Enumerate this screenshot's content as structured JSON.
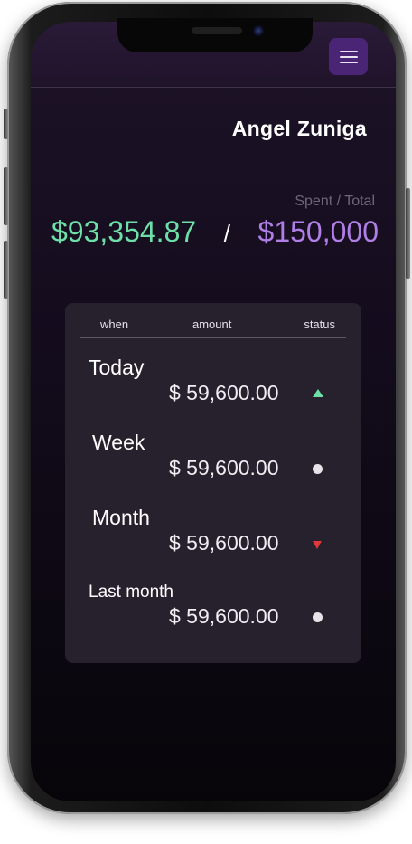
{
  "header": {
    "user_name": "Angel Zuniga",
    "menu_icon": "hamburger-menu-icon",
    "accent_color": "#4a2575"
  },
  "summary": {
    "caption": "Spent / Total",
    "spent": "$93,354.87",
    "separator": "/",
    "total": "$150,000",
    "spent_color": "#6fdfa9",
    "total_color": "#b07fe6"
  },
  "table": {
    "columns": [
      "when",
      "amount",
      "status"
    ],
    "rows": [
      {
        "when": "Today",
        "amount": "$ 59,600.00",
        "status": "up",
        "status_icon": "triangle-up-icon",
        "status_color": "#6fdfa9"
      },
      {
        "when": "Week",
        "amount": "$ 59,600.00",
        "status": "neutral",
        "status_icon": "dot-icon",
        "status_color": "#e6e4e8"
      },
      {
        "when": "Month",
        "amount": "$ 59,600.00",
        "status": "down",
        "status_icon": "triangle-down-icon",
        "status_color": "#e0383a"
      },
      {
        "when": "Last month",
        "amount": "$ 59,600.00",
        "status": "neutral",
        "status_icon": "dot-icon",
        "status_color": "#e6e4e8"
      }
    ]
  }
}
